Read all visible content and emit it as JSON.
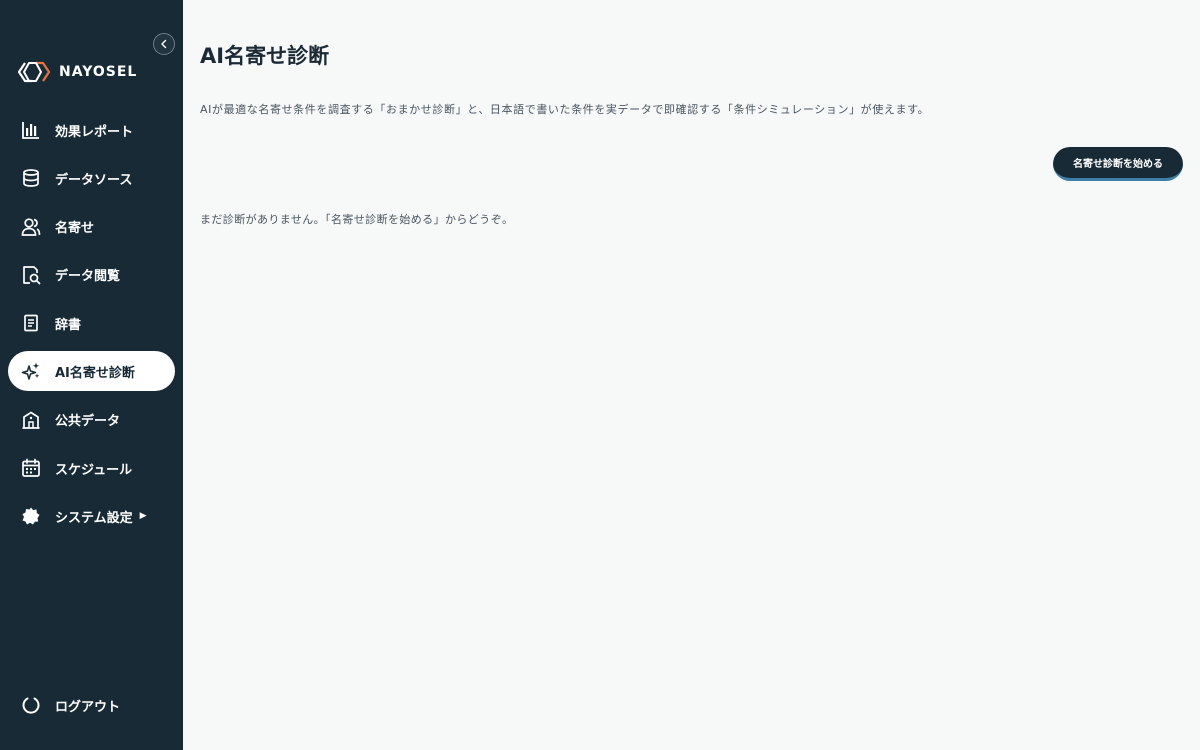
{
  "sidebar": {
    "logo_text": "NAYOSEL",
    "nav_items": [
      {
        "label": "効果レポート",
        "icon": "bar-chart-icon",
        "active": false
      },
      {
        "label": "データソース",
        "icon": "database-icon",
        "active": false
      },
      {
        "label": "名寄せ",
        "icon": "users-icon",
        "active": false
      },
      {
        "label": "データ閲覧",
        "icon": "document-search-icon",
        "active": false
      },
      {
        "label": "辞書",
        "icon": "book-icon",
        "active": false
      },
      {
        "label": "AI名寄せ診断",
        "icon": "sparkles-icon",
        "active": true
      },
      {
        "label": "公共データ",
        "icon": "building-icon",
        "active": false
      },
      {
        "label": "スケジュール",
        "icon": "calendar-icon",
        "active": false
      },
      {
        "label": "システム設定",
        "icon": "gear-icon",
        "active": false,
        "has_submenu": true
      }
    ],
    "logout_label": "ログアウト"
  },
  "main": {
    "title": "AI名寄せ診断",
    "description": "AIが最適な名寄せ条件を調査する「おまかせ診断」と、日本語で書いた条件を実データで即確認する「条件シミュレーション」が使えます。",
    "start_button_label": "名寄せ診断を始める",
    "empty_message": "まだ診断がありません。「名寄せ診断を始める」からどうぞ。"
  },
  "colors": {
    "sidebar_bg": "#182a36",
    "main_bg": "#f7f8f8",
    "logo_accent": "#e8743b",
    "button_underline": "#3e7fa6"
  }
}
